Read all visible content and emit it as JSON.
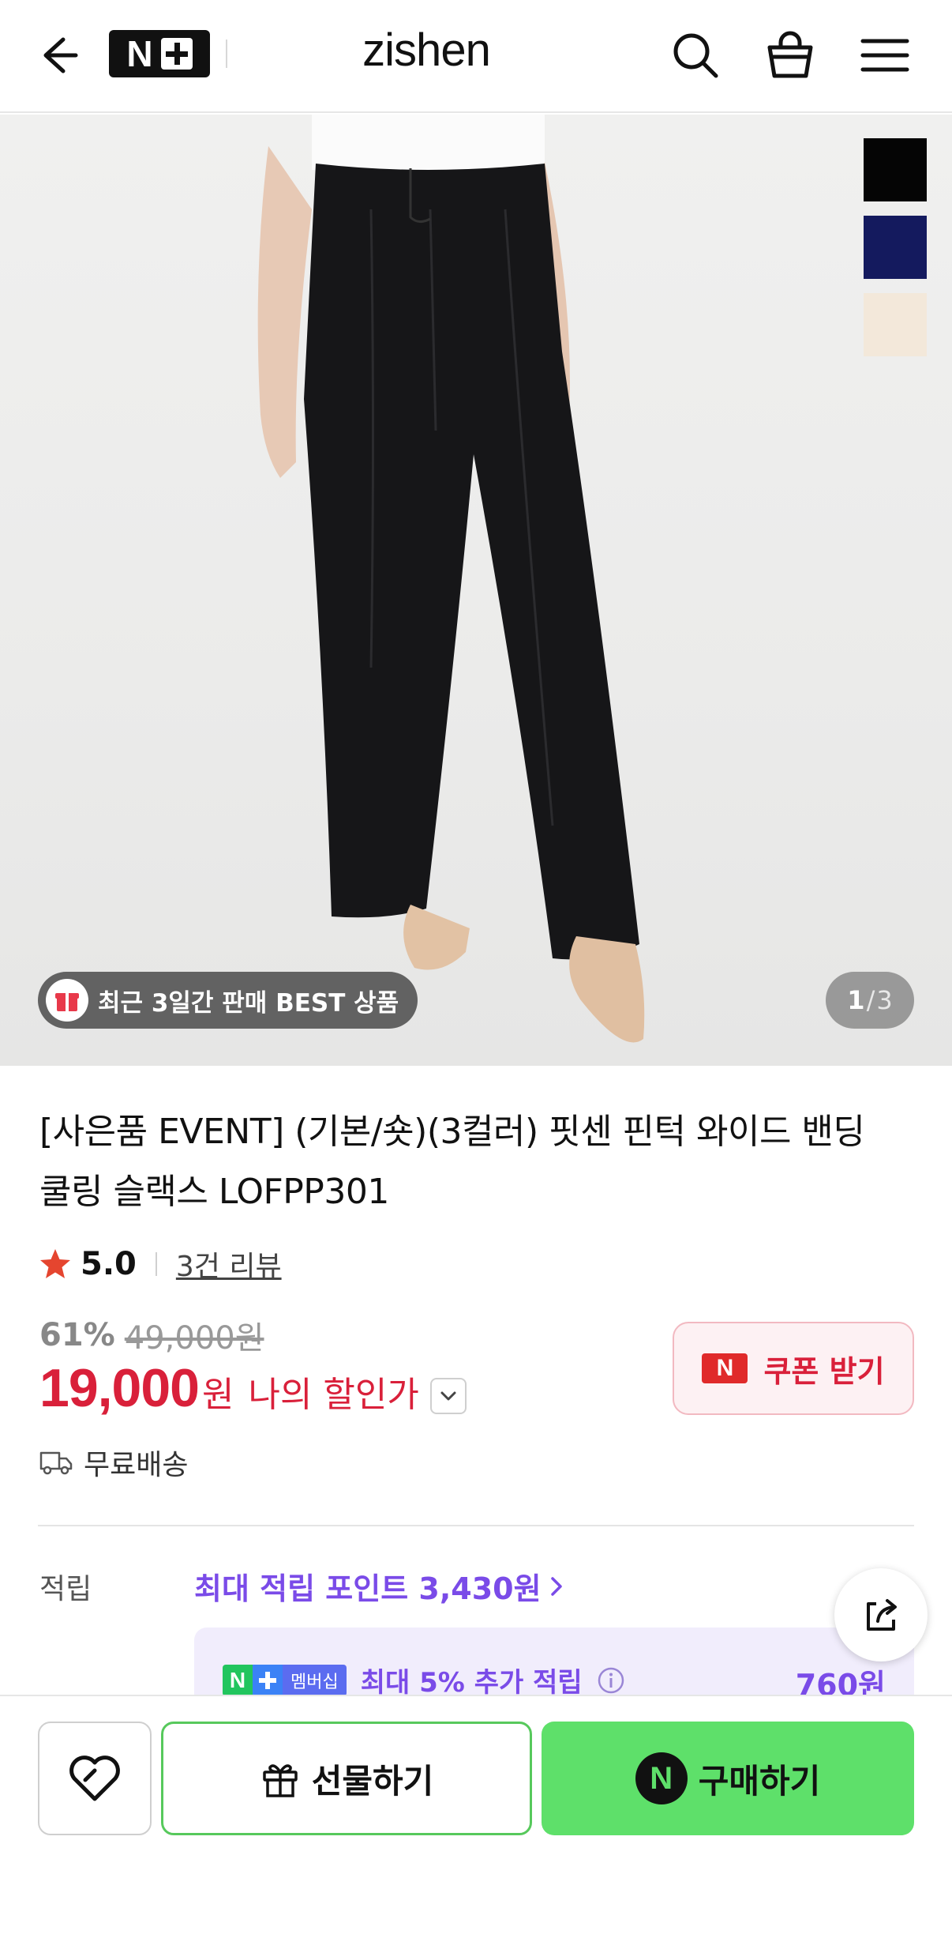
{
  "header": {
    "nplus_logo_letter": "N",
    "brand": "zishen"
  },
  "hero": {
    "swatch_colors": [
      "#050505",
      "#141a5e",
      "#f3e8da"
    ],
    "best_badge": "최근 3일간 판매 BEST 상품",
    "page_current": "1",
    "page_separator": "/",
    "page_total": "3"
  },
  "product": {
    "title_line1": "[사은품 EVENT] (기본/숏)(3컬러) 핏센 핀턱 와이드 밴딩",
    "title_line2": "쿨링 슬랙스 LOFPP301",
    "rating": "5.0",
    "review_link": "3건 리뷰",
    "discount_pct": "61%",
    "original_price": "49,000원",
    "price": "19,000",
    "currency": "원",
    "my_discount_label": "나의 할인가",
    "coupon_icon_letter": "N",
    "coupon_label": "쿠폰 받기",
    "shipping": "무료배송"
  },
  "points": {
    "label": "적립",
    "max_points_link": "최대 적립 포인트 3,430원",
    "membership_n": "N",
    "membership_badge": "멤버십",
    "membership_text": "최대 5% 추가 적립",
    "membership_amount": "760원"
  },
  "bottom_bar": {
    "gift_label": "선물하기",
    "buy_icon_letter": "N",
    "buy_label": "구매하기"
  },
  "colors": {
    "price_red": "#d9203a",
    "point_purple": "#7a4be8",
    "buy_green": "#5ee06a"
  }
}
